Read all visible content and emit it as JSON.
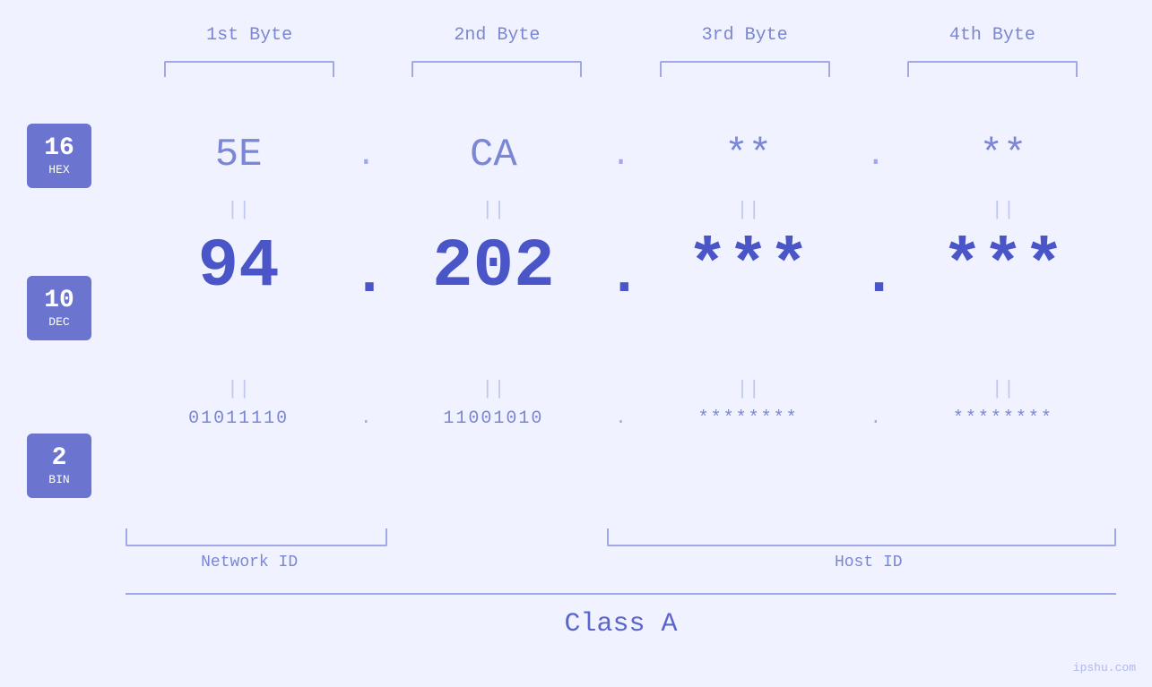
{
  "page": {
    "background": "#f0f2ff",
    "watermark": "ipshu.com"
  },
  "headers": {
    "byte1": "1st Byte",
    "byte2": "2nd Byte",
    "byte3": "3rd Byte",
    "byte4": "4th Byte"
  },
  "labels": {
    "hex_num": "16",
    "hex_unit": "HEX",
    "dec_num": "10",
    "dec_unit": "DEC",
    "bin_num": "2",
    "bin_unit": "BIN"
  },
  "hex_row": {
    "v1": "5E",
    "dot1": ".",
    "v2": "CA",
    "dot2": ".",
    "v3": "**",
    "dot3": ".",
    "v4": "**"
  },
  "dec_row": {
    "v1": "94",
    "dot1": ".",
    "v2": "202",
    "dot2": ".",
    "v3": "***",
    "dot3": ".",
    "v4": "***"
  },
  "bin_row": {
    "v1": "01011110",
    "dot1": ".",
    "v2": "11001010",
    "dot2": ".",
    "v3": "********",
    "dot3": ".",
    "v4": "********"
  },
  "eq_sign": "||",
  "network_id": "Network ID",
  "host_id": "Host ID",
  "class_label": "Class A"
}
